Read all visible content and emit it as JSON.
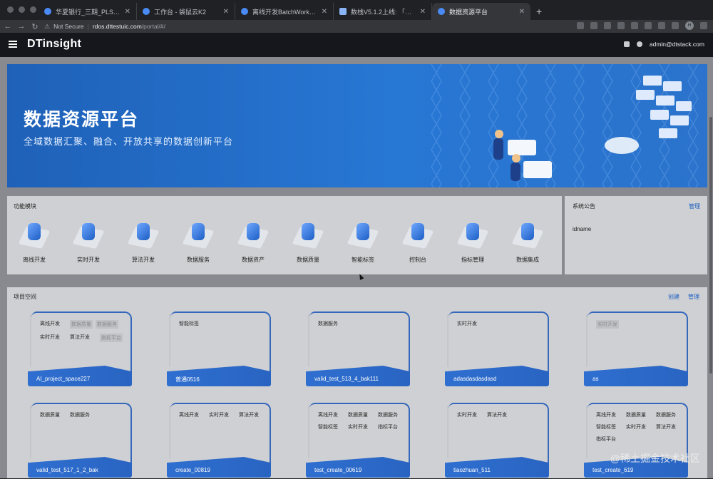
{
  "browser": {
    "tabs": [
      {
        "title": "华夏银行_三期_PLS-需求列表 -",
        "active": false
      },
      {
        "title": "工作台 - 袋鼠云K2",
        "active": false
      },
      {
        "title": "离线开发BatchWorks 2022年新",
        "active": false
      },
      {
        "title": "数栈V5.1.2上线: 「项目空间」",
        "active": false
      },
      {
        "title": "数据资源平台",
        "active": true
      }
    ],
    "new_tab": "+",
    "security_label": "Not Secure",
    "host": "rdos.dttestuic.com",
    "path": "/portal/#/",
    "profile_initial": "H"
  },
  "header": {
    "logo": "DTinsight",
    "user": "admin@dtstack.com"
  },
  "banner": {
    "title": "数据资源平台",
    "subtitle": "全域数据汇聚、融合、开放共享的数据创新平台"
  },
  "modules": {
    "title": "功能模块",
    "items": [
      {
        "label": "离线开发",
        "icon": "offline-dev-icon"
      },
      {
        "label": "实时开发",
        "icon": "realtime-dev-icon"
      },
      {
        "label": "算法开发",
        "icon": "algorithm-dev-icon"
      },
      {
        "label": "数据服务",
        "icon": "data-service-icon"
      },
      {
        "label": "数据资产",
        "icon": "data-asset-icon"
      },
      {
        "label": "数据质量",
        "icon": "data-quality-icon"
      },
      {
        "label": "智能标签",
        "icon": "smart-tag-icon"
      },
      {
        "label": "控制台",
        "icon": "console-icon"
      },
      {
        "label": "指标管理",
        "icon": "metrics-icon"
      },
      {
        "label": "数据集成",
        "icon": "data-integration-icon"
      }
    ]
  },
  "notice": {
    "title": "系统公告",
    "manage": "管理",
    "items": [
      "idname"
    ]
  },
  "projects": {
    "title": "项目空间",
    "create": "创建",
    "manage": "管理",
    "cards": [
      {
        "name": "AI_project_space227",
        "tags": [
          {
            "t": "离线开发"
          },
          {
            "t": "数据质量",
            "d": true
          },
          {
            "t": "数据服务",
            "d": true
          },
          {
            "t": "实时开发"
          },
          {
            "t": "算法开发"
          },
          {
            "t": "指标平台",
            "d": true
          }
        ]
      },
      {
        "name": "普通0516",
        "tags": [
          {
            "t": "智能标签"
          }
        ]
      },
      {
        "name": "valid_test_513_4_bak111",
        "tags": [
          {
            "t": "数据服务"
          }
        ]
      },
      {
        "name": "adasdasdasdasd",
        "tags": [
          {
            "t": "实时开发"
          }
        ]
      },
      {
        "name": "as",
        "tags": [
          {
            "t": "实时开发",
            "d": true
          }
        ]
      },
      {
        "name": "valid_test_517_1_2_bak",
        "tags": [
          {
            "t": "数据质量"
          },
          {
            "t": "数据服务"
          }
        ]
      },
      {
        "name": "create_00819",
        "tags": [
          {
            "t": "离线开发"
          },
          {
            "t": "实时开发"
          },
          {
            "t": "算法开发"
          }
        ]
      },
      {
        "name": "test_create_00619",
        "tags": [
          {
            "t": "离线开发"
          },
          {
            "t": "数据质量"
          },
          {
            "t": "数据服务"
          },
          {
            "t": "智能标签"
          },
          {
            "t": "实时开发"
          },
          {
            "t": "指标平台"
          }
        ]
      },
      {
        "name": "tiaozhuan_511",
        "tags": [
          {
            "t": "实时开发"
          },
          {
            "t": "算法开发"
          }
        ]
      },
      {
        "name": "test_create_619",
        "tags": [
          {
            "t": "离线开发"
          },
          {
            "t": "数据质量"
          },
          {
            "t": "数据服务"
          },
          {
            "t": "智能标签"
          },
          {
            "t": "实时开发"
          },
          {
            "t": "算法开发"
          },
          {
            "t": "指标平台"
          }
        ]
      }
    ]
  },
  "watermark": "@稀土掘金技术社区",
  "colors": {
    "accent": "#2f6fd0",
    "header_bg": "#16171c"
  }
}
